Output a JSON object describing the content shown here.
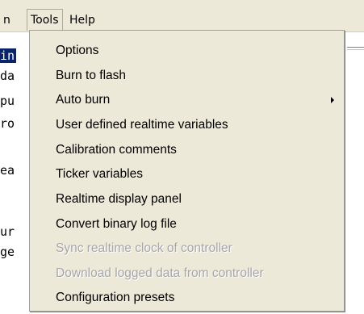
{
  "menubar": {
    "partial_label": "n",
    "tools_label": "Tools",
    "help_label": "Help"
  },
  "editor_lines": [
    {
      "text": "in",
      "selected": true
    },
    {
      "text": "da",
      "selected": false
    },
    {
      "text": "pu",
      "selected": false
    },
    {
      "text": "ro",
      "selected": false
    },
    {
      "text": "ea",
      "selected": false
    },
    {
      "text": "ur",
      "selected": false
    },
    {
      "text": "ge",
      "selected": false
    }
  ],
  "tools_menu": {
    "items": [
      {
        "label": "Options",
        "enabled": true,
        "submenu": false
      },
      {
        "label": "Burn to flash",
        "enabled": true,
        "submenu": false
      },
      {
        "label": "Auto burn",
        "enabled": true,
        "submenu": true
      },
      {
        "label": "User defined realtime variables",
        "enabled": true,
        "submenu": false
      },
      {
        "label": "Calibration comments",
        "enabled": true,
        "submenu": false
      },
      {
        "label": "Ticker variables",
        "enabled": true,
        "submenu": false
      },
      {
        "label": "Realtime display panel",
        "enabled": true,
        "submenu": false
      },
      {
        "label": "Convert binary log file",
        "enabled": true,
        "submenu": false
      },
      {
        "label": "Sync realtime clock of controller",
        "enabled": false,
        "submenu": false
      },
      {
        "label": "Download logged data from controller",
        "enabled": false,
        "submenu": false
      },
      {
        "label": "Configuration presets",
        "enabled": true,
        "submenu": false
      }
    ]
  }
}
